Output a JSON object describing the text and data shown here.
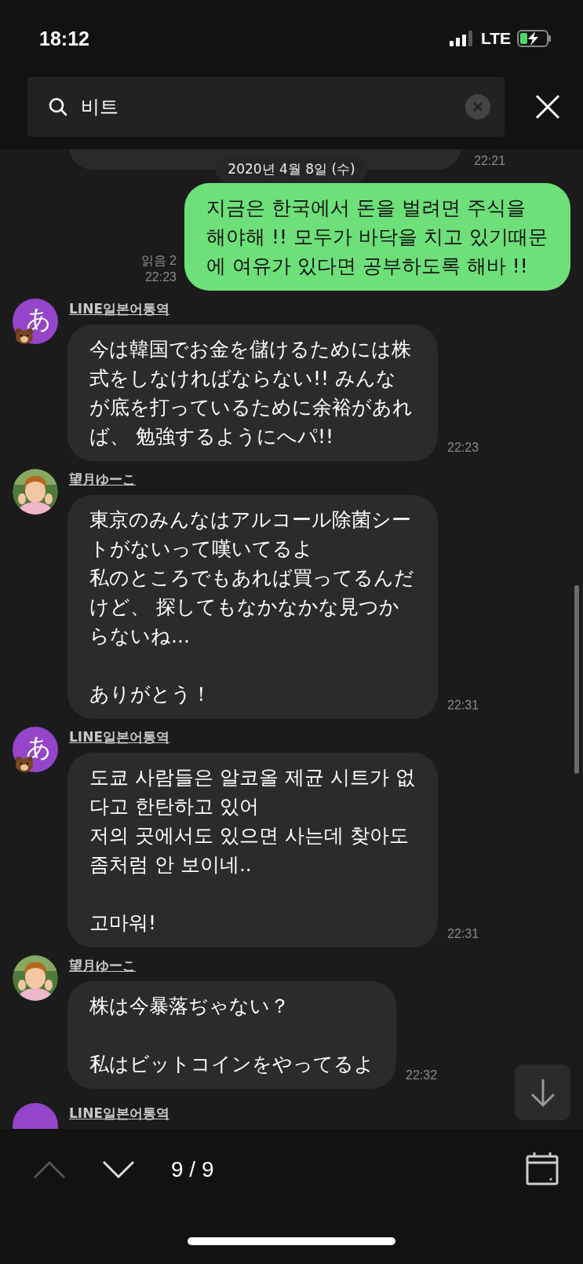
{
  "status_bar": {
    "time": "18:12",
    "network": "LTE"
  },
  "search": {
    "value": "비트"
  },
  "date_chip": "2020년 4월 8일 (수)",
  "messages": [
    {
      "kind": "partial",
      "time": "22:21"
    },
    {
      "kind": "sent",
      "read": "읽음 2",
      "time": "22:23",
      "text": [
        [
          "지금은 한국에서 돈을 벌려면 주식을 해야해 !! 모두가 바닥을 치고 있기때문에  여유가 있다면 공부하도록 해바 !!"
        ]
      ]
    },
    {
      "kind": "received",
      "sender": "LINE일본어통역",
      "avatar": {
        "kind": "letter",
        "letter": "あ"
      },
      "time": "22:23",
      "text": [
        [
          "今は韓国でお金を儲けるためには株式をしなければならない!! みんなが底を打っているために余裕があれば、 勉強するようにへパ!!"
        ]
      ]
    },
    {
      "kind": "received",
      "sender": "望月ゆーこ",
      "avatar": {
        "kind": "picture"
      },
      "time": "22:31",
      "text": [
        [
          "東京のみんなはアルコール除菌シートがないって嘆いてるよ",
          "私のところでもあれば買ってるんだけど、 探してもなかなかな見つからないね..."
        ],
        [
          "ありがとう！"
        ]
      ]
    },
    {
      "kind": "received",
      "sender": "LINE일본어통역",
      "avatar": {
        "kind": "letter",
        "letter": "あ"
      },
      "time": "22:31",
      "text": [
        [
          "도쿄 사람들은 알코올 제균 시트가 없다고 한탄하고 있어",
          "저의 곳에서도 있으면 사는데 찾아도 좀처럼 안 보이네.."
        ],
        [
          "고마워!"
        ]
      ]
    },
    {
      "kind": "received",
      "sender": "望月ゆーこ",
      "avatar": {
        "kind": "picture"
      },
      "time": "22:32",
      "text": [
        [
          "株は今暴落ぢゃない？"
        ],
        [
          "私はビットコインをやってるよ"
        ]
      ]
    },
    {
      "kind": "cut",
      "sender": "LINE일본어통역",
      "avatar": {
        "kind": "letter"
      }
    }
  ],
  "navigator": {
    "up_disabled": true,
    "down_disabled": false,
    "count": "9 / 9"
  }
}
